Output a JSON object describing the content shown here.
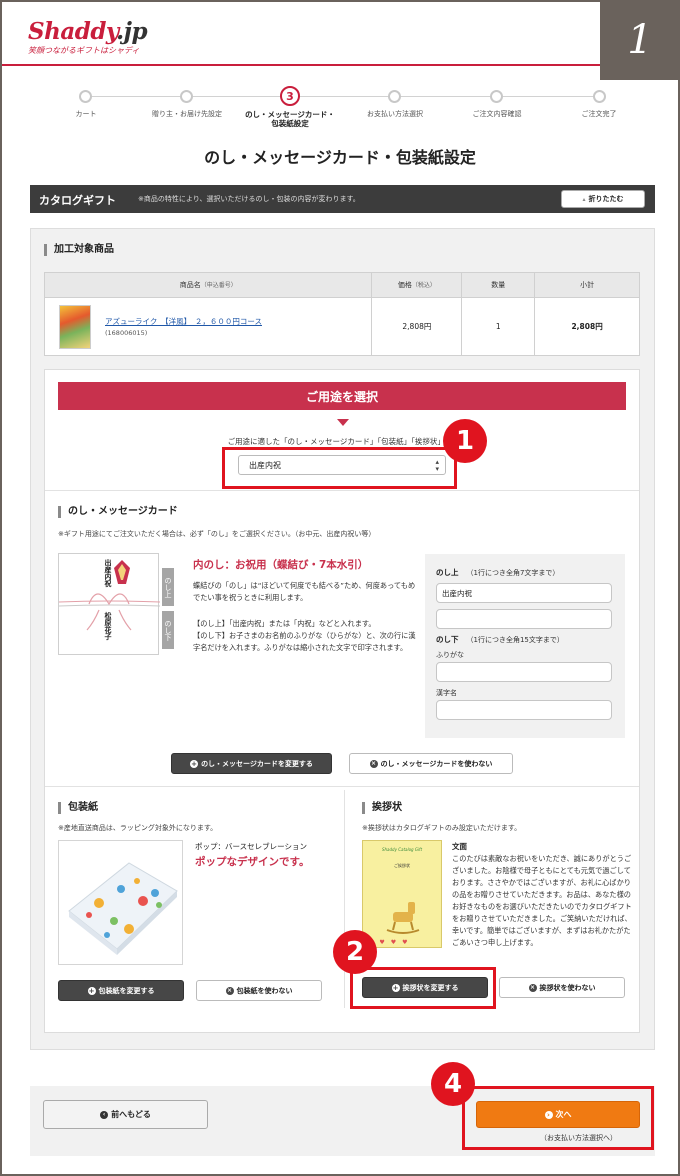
{
  "header": {
    "logo_main": "Shaddy",
    "logo_suffix": ".jp",
    "tagline": "笑顔つながるギフトはシャディ",
    "step_number": "1"
  },
  "steps": [
    {
      "label": "カート"
    },
    {
      "label": "贈り主・お届け先設定"
    },
    {
      "label": "のし・メッセージカード・\n包装紙設定",
      "number": "3"
    },
    {
      "label": "お支払い方法選択"
    },
    {
      "label": "ご注文内容確認"
    },
    {
      "label": "ご注文完了"
    }
  ],
  "page_title": "のし・メッセージカード・包装紙設定",
  "catalog": {
    "title": "カタログギフト",
    "note": "※商品の特性により、選択いただけるのし・包装の内容が変わります。",
    "fold_button": "折りたたむ"
  },
  "products": {
    "section_title": "加工対象商品",
    "headers": {
      "name": "商品名",
      "name_sub": "（申込番号）",
      "price": "価格",
      "price_sub": "（税込）",
      "qty": "数量",
      "subtotal": "小計"
    },
    "row": {
      "name": "アズューライク　【洋風】　２，６００円コース",
      "code": "(168006015)",
      "price": "2,808円",
      "qty": "1",
      "subtotal": "2,808円"
    }
  },
  "purpose": {
    "title": "ご用途を選択",
    "note": "ご用途に適した「のし・メッセージカード」「包装紙」「挨拶状」が",
    "selected": "出産内祝"
  },
  "noshi": {
    "section_title": "のし・メッセージカード",
    "note": "※ギフト用途にてご注文いただく場合は、必ず「のし」をご選択ください。（お中元、出産内祝い等）",
    "card_upper": "出産内祝",
    "card_lower": "松原花子",
    "side_upper": "のし上",
    "side_lower": "のし下",
    "type_title": "内のし：お祝用（蝶結び・7本水引）",
    "desc1": "蝶結びの「のし」は“ほどいて何度でも結べる”ため、何度あってもめでたい事を祝うときに利用します。",
    "desc2": "【のし上】「出産内祝」または「内祝」などと入れます。",
    "desc3": "【のし下】お子さまのお名前のふりがな（ひらがな）と、次の行に漢字名だけを入れます。ふりがなは縮小された文字で印字されます。",
    "form": {
      "upper_label": "のし上",
      "upper_hint": "（1行につき全角7文字まで）",
      "upper_value": "出産内祝",
      "lower_label": "のし下",
      "lower_hint": "（1行につき全角15文字まで）",
      "furigana_label": "ふりがな",
      "kanji_label": "漢字名"
    },
    "change_button": "のし・メッセージカードを変更する",
    "nouse_button": "のし・メッセージカードを使わない"
  },
  "wrapping": {
    "section_title": "包装紙",
    "note": "※産地直送商品は、ラッピング対象外になります。",
    "name": "ポップ：バースセレブレーション",
    "catch": "ポップなデザインです。",
    "change_button": "包装紙を変更する",
    "nouse_button": "包装紙を使わない"
  },
  "greeting": {
    "section_title": "挨拶状",
    "note": "※挨拶状はカタログギフトのみ設定いただけます。",
    "card_title": "Shaddy Catalog Gift",
    "card_sub": "ご挨拶状",
    "body_label": "文面",
    "body": "このたびは素敵なお祝いをいただき、誠にありがとうございました。お陰様で母子ともにとても元気で過ごしております。ささやかではございますが、お礼に心ばかりの品をお贈りさせていただきます。お品は、あなた様のお好きなものをお選びいただきたいのでカタログギフトをお贈りさせていただきました。ご笑納いただければ、幸いです。簡単ではございますが、まずはお礼かたがたごあいさつ申し上げます。",
    "change_button": "挨拶状を変更する",
    "nouse_button": "挨拶状を使わない"
  },
  "footer": {
    "back_button": "前へもどる",
    "next_button": "次へ",
    "next_sub": "（お支払い方法選択へ）"
  },
  "annotations": {
    "a1": "1",
    "a2": "2",
    "a4": "4"
  },
  "colors": {
    "brand": "#c91e3c",
    "accent": "#c8314d",
    "next": "#f07a12",
    "highlight": "#e0141f"
  }
}
